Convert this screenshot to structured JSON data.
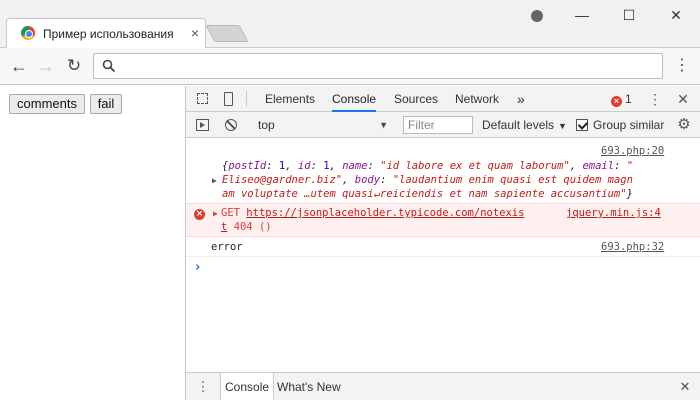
{
  "browser": {
    "tab_title": "Пример использования",
    "tab_close": "×",
    "window": {
      "minimize": "—",
      "maximize": "☐",
      "close": "✕"
    },
    "nav": {
      "back": "←",
      "forward": "→",
      "reload": "↻",
      "menu": "⋮"
    },
    "omnibox_value": ""
  },
  "page": {
    "buttons": {
      "comments": "comments",
      "fail": "fail"
    }
  },
  "devtools": {
    "tabs": [
      "Elements",
      "Console",
      "Sources",
      "Network",
      "»"
    ],
    "active_tab": "Console",
    "error_count": "1",
    "kebab": "⋮",
    "close": "✕",
    "context": "top",
    "filter_placeholder": "Filter",
    "levels": "Default levels",
    "group_similar": "Group similar",
    "gear": "⚙",
    "messages": {
      "obj": {
        "source": "693.php:20",
        "line1_open": "{",
        "k_postId": "postId",
        "v_postId": "1",
        "k_id": "id",
        "v_id": "1",
        "k_name": "name",
        "v_name": "\"id labore ex et quam laborum\"",
        "k_email": "email",
        "v_email_1": "\"",
        "v_email_2": "Eliseo@gardner.biz\"",
        "k_body": "body",
        "v_body_1": "\"laudantium enim quasi est quidem magn",
        "v_body_2": "am voluptate …utem quasi↵reiciendis et nam sapiente accusantium\"",
        "close": "}"
      },
      "err": {
        "method": "GET",
        "url": "https://jsonplaceholder.typicode.com/notexis",
        "url_tail": "t",
        "status": "404 ()",
        "source": "jquery.min.js:4"
      },
      "log": {
        "text": "error",
        "source": "693.php:32"
      }
    },
    "prompt": "›",
    "drawer": {
      "console": "Console",
      "whatsnew": "What's New",
      "kebab": "⋮",
      "close": "✕"
    }
  },
  "colors": {
    "error_red": "#e03c2e",
    "active_tab_underline": "#1a73e8",
    "console_key": "#881391",
    "console_string": "#c41a16",
    "console_number": "#1c00cf"
  },
  "icons": [
    "chrome-favicon",
    "profile-icon",
    "search-icon",
    "inspect-icon",
    "device-icon",
    "sidebar-toggle-icon",
    "clear-console-icon",
    "gear-icon",
    "error-icon",
    "expand-arrow-icon"
  ]
}
